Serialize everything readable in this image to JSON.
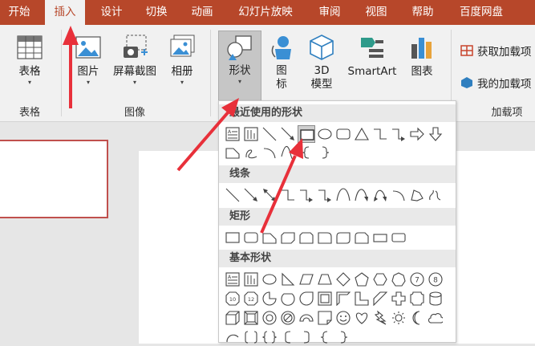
{
  "tabs": [
    {
      "id": "home",
      "label": "开始"
    },
    {
      "id": "insert",
      "label": "插入",
      "active": true
    },
    {
      "id": "design",
      "label": "设计"
    },
    {
      "id": "transitions",
      "label": "切换"
    },
    {
      "id": "animations",
      "label": "动画"
    },
    {
      "id": "slideshow",
      "label": "幻灯片放映"
    },
    {
      "id": "review",
      "label": "审阅"
    },
    {
      "id": "view",
      "label": "视图"
    },
    {
      "id": "help",
      "label": "帮助"
    },
    {
      "id": "baidu",
      "label": "百度网盘"
    }
  ],
  "ribbon": {
    "groups": {
      "tables": "表格",
      "images": "图像",
      "addins": "加载项"
    },
    "buttons": {
      "table": "表格",
      "pictures": "图片",
      "screenshot": "屏幕截图",
      "album": "相册",
      "shapes": "形状",
      "icons_1": "图",
      "icons_2": "标",
      "model_1": "3D",
      "model_2": "模型",
      "smartart": "SmartArt",
      "chart": "图表",
      "get_addins": "获取加载项",
      "my_addins": "我的加载项"
    },
    "dropdown_arrow": "▾"
  },
  "shapes_menu": {
    "sections": {
      "recent": "最近使用的形状",
      "lines": "线条",
      "rectangles": "矩形",
      "basic": "基本形状"
    }
  },
  "colors": {
    "ribbon_bar": "#b7472a",
    "annotation_arrow": "#e8303a"
  }
}
